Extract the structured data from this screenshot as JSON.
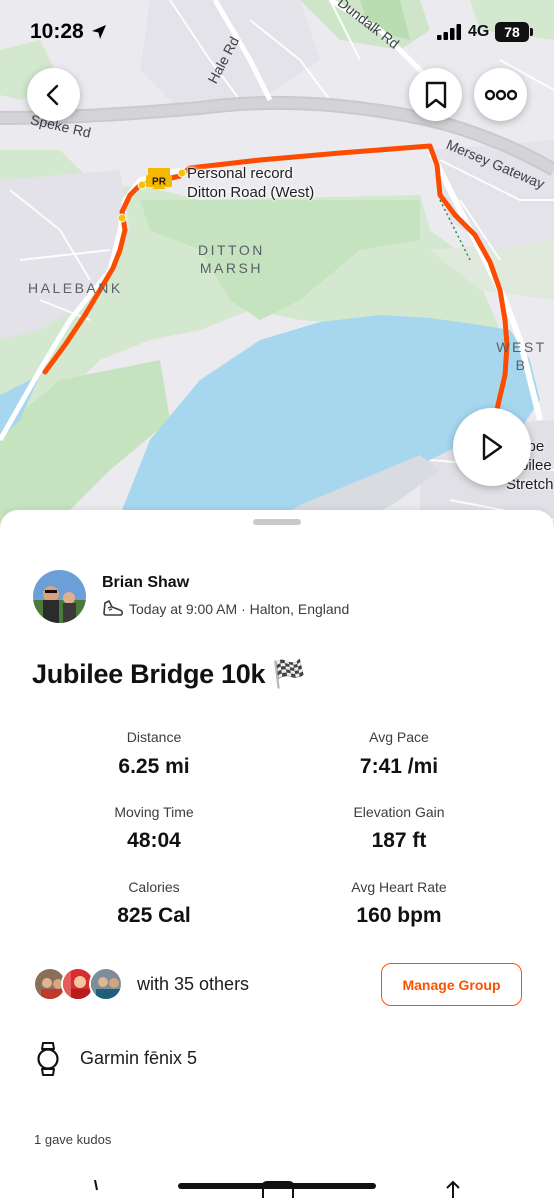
{
  "status_bar": {
    "time": "10:28",
    "network": "4G",
    "battery": "78",
    "location_icon": "location-arrow-icon",
    "signal_icon": "signal-bars-icon"
  },
  "map": {
    "road_labels": {
      "speke_rd": "Speke Rd",
      "hale_rd": "Hale Rd",
      "dundalk_rd": "Dundalk Rd",
      "mersey_gateway": "Mersey Gateway"
    },
    "place_labels": {
      "ditton_marsh": "DITTON\nMARSH",
      "halebank": "HALEBANK",
      "west_bank": "WEST B"
    },
    "pr_badge": "PR",
    "pr_title": "Personal record",
    "pr_segment": "Ditton Road (West)",
    "edge_text": {
      "line1": "l be",
      "line2": "bilee",
      "line3": "Stretch"
    },
    "route_color": "#fc4c02",
    "water_color": "#a8d8f0",
    "park_color": "#c8e6c4"
  },
  "buttons": {
    "back": "chevron-left-icon",
    "bookmark": "bookmark-icon",
    "more": "more-horizontal-icon",
    "play": "play-icon"
  },
  "athlete": {
    "name": "Brian Shaw",
    "meta": "Today at 9:00 AM · Halton, England",
    "sport_icon": "running-shoe-icon"
  },
  "activity": {
    "title": "Jubilee Bridge 10k 🏁"
  },
  "stats": [
    {
      "label": "Distance",
      "value": "6.25 mi"
    },
    {
      "label": "Avg Pace",
      "value": "7:41 /mi"
    },
    {
      "label": "Moving Time",
      "value": "48:04"
    },
    {
      "label": "Elevation Gain",
      "value": "187 ft"
    },
    {
      "label": "Calories",
      "value": "825 Cal"
    },
    {
      "label": "Avg Heart Rate",
      "value": "160 bpm"
    }
  ],
  "group": {
    "text": "with 35 others",
    "button_label": "Manage Group"
  },
  "device": {
    "name": "Garmin fēnix 5",
    "icon": "watch-icon"
  },
  "kudos": {
    "text": "1 gave kudos"
  },
  "colors": {
    "accent": "#fc5200",
    "text_primary": "#111111",
    "text_secondary": "#3c3c43"
  }
}
